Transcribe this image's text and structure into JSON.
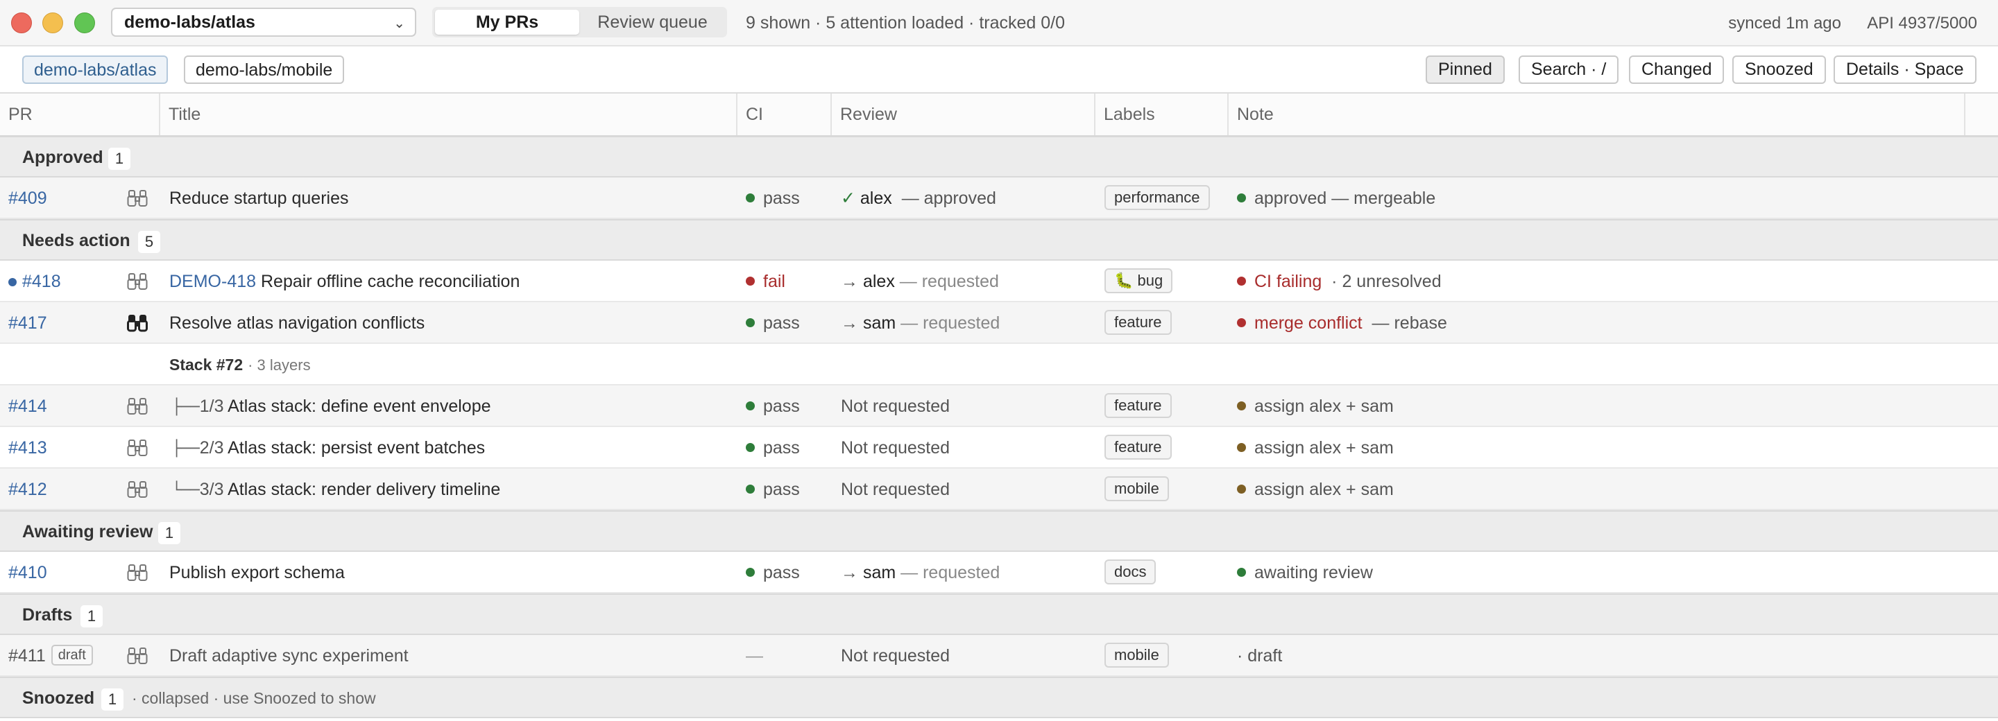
{
  "window": {
    "repo_select": "demo-labs/atlas",
    "tabs": [
      {
        "label": "My PRs",
        "active": true
      },
      {
        "label": "Review queue",
        "active": false
      }
    ],
    "summary": "9 shown · 5 attention loaded · tracked 0/0",
    "synced": "synced 1m ago",
    "api": "API 4937/5000"
  },
  "toolbar": {
    "repos": [
      "demo-labs/atlas",
      "demo-labs/mobile"
    ],
    "buttons": [
      "Pinned",
      "Search · /",
      "Changed",
      "Snoozed",
      "Details · Space"
    ]
  },
  "columns": [
    "PR",
    "Title",
    "CI",
    "Review",
    "Labels",
    "Note"
  ],
  "groups": {
    "approved": {
      "title": "Approved",
      "count": "1"
    },
    "needs_action": {
      "title": "Needs action",
      "count": "5"
    },
    "awaiting": {
      "title": "Awaiting review",
      "count": "1"
    },
    "drafts": {
      "title": "Drafts",
      "count": "1"
    },
    "snoozed": {
      "title": "Snoozed",
      "count": "1",
      "note": "· collapsed · use Snoozed to show"
    }
  },
  "stack": {
    "title": "Stack #72",
    "sub": "· 3 layers"
  },
  "prs": [
    {
      "number": "#409",
      "title": "Reduce startup queries",
      "ci": "pass",
      "reviewer": "alex",
      "review_status": "— approved",
      "label": "performance",
      "note": "approved — mergeable"
    },
    {
      "number": "#418",
      "ticket": "DEMO-418",
      "title": "Repair offline cache reconciliation",
      "ci": "fail",
      "reviewer": "alex",
      "review_status": "— requested",
      "label": "🐛 bug",
      "note": "CI failing",
      "note_extra": "· 2 unresolved"
    },
    {
      "number": "#417",
      "title": "Resolve atlas navigation conflicts",
      "ci": "pass",
      "reviewer": "sam",
      "review_status": "— requested",
      "label": "feature",
      "note": "merge conflict",
      "note_extra": "— rebase"
    },
    {
      "number": "#414",
      "tree": "├──",
      "layer": "1/3",
      "title": "Atlas stack: define event envelope",
      "ci": "pass",
      "review": "Not requested",
      "label": "feature",
      "note": "assign alex + sam"
    },
    {
      "number": "#413",
      "tree": "├──",
      "layer": "2/3",
      "title": "Atlas stack: persist event batches",
      "ci": "pass",
      "review": "Not requested",
      "label": "feature",
      "note": "assign alex + sam"
    },
    {
      "number": "#412",
      "tree": "└──",
      "layer": "3/3",
      "title": "Atlas stack: render delivery timeline",
      "ci": "pass",
      "review": "Not requested",
      "label": "mobile",
      "note": "assign alex + sam"
    },
    {
      "number": "#410",
      "title": "Publish export schema",
      "ci": "pass",
      "reviewer": "sam",
      "review_status": "— requested",
      "label": "docs",
      "note": "awaiting review"
    },
    {
      "number": "#411",
      "badge": "draft",
      "title": "Draft adaptive sync experiment",
      "ci": "—",
      "review": "Not requested",
      "label": "mobile",
      "note": "· draft"
    }
  ],
  "colors": {
    "link": "#3866a3",
    "pass": "#2e7d3a",
    "fail": "#b03030",
    "pending": "#7d5f24"
  },
  "icons": {
    "watch": "binoculars-icon",
    "approved": "check-icon",
    "requested": "arrow-right-icon",
    "repo_dropdown": "chevron-down-icon"
  }
}
